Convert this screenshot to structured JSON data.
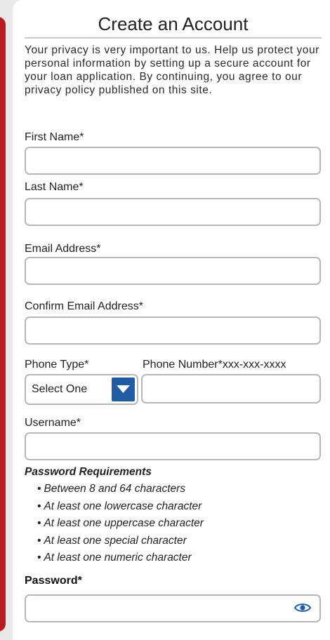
{
  "form": {
    "title": "Create an Account",
    "intro": "Your privacy is very important to us. Help us protect  your personal information by setting up a secure account for your loan application. By continuing, you agree to our privacy policy published on this site.",
    "first_name_label": "First Name*",
    "last_name_label": "Last Name*",
    "email_label": "Email Address*",
    "confirm_email_label": "Confirm Email Address*",
    "phone_type_label": "Phone Type*",
    "phone_type_selected": "Select One",
    "phone_number_label": "Phone Number*xxx-xxx-xxxx",
    "username_label": "Username*",
    "password_requirements_title": "Password Requirements",
    "password_requirements": [
      "Between 8 and 64 characters",
      "At least one lowercase character",
      "At least one uppercase character",
      "At least one special character",
      "At least one numeric character"
    ],
    "password_label": "Password*",
    "password_toggle_icon": "eye-icon"
  },
  "colors": {
    "accent": "#1e5da6",
    "border": "#b7b7b7",
    "edge": "#b81b20"
  }
}
